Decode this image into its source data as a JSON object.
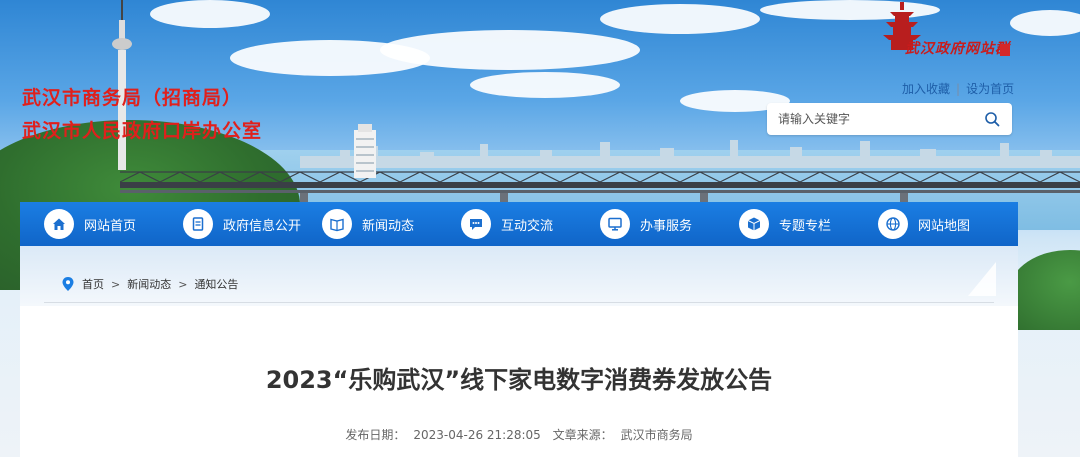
{
  "header": {
    "site_name_line1": "武汉市商务局（招商局）",
    "site_name_line2": "武汉市人民政府口岸办公室",
    "portal_logo_text": "武汉政府网站群",
    "links": {
      "favorite": "加入收藏",
      "separator": "|",
      "homepage": "设为首页"
    },
    "search": {
      "placeholder": "请输入关键字",
      "value": ""
    }
  },
  "nav": {
    "items": [
      {
        "label": "网站首页",
        "icon": "home-icon"
      },
      {
        "label": "政府信息公开",
        "icon": "document-icon"
      },
      {
        "label": "新闻动态",
        "icon": "news-icon"
      },
      {
        "label": "互动交流",
        "icon": "chat-icon"
      },
      {
        "label": "办事服务",
        "icon": "monitor-icon"
      },
      {
        "label": "专题专栏",
        "icon": "cube-icon"
      },
      {
        "label": "网站地图",
        "icon": "globe-icon"
      }
    ]
  },
  "breadcrumb": {
    "home": "首页",
    "sep1": ">",
    "news": "新闻动态",
    "sep2": ">",
    "current": "通知公告"
  },
  "article": {
    "title": "2023“乐购武汉”线下家电数字消费券发放公告",
    "date_label": "发布日期：",
    "date": "2023-04-26 21:28:05",
    "source_label": "文章来源：",
    "source": "武汉市商务局"
  },
  "colors": {
    "accent_red": "#e0201c",
    "nav_blue": "#1b7ee3",
    "link_blue": "#1e5ea8"
  }
}
